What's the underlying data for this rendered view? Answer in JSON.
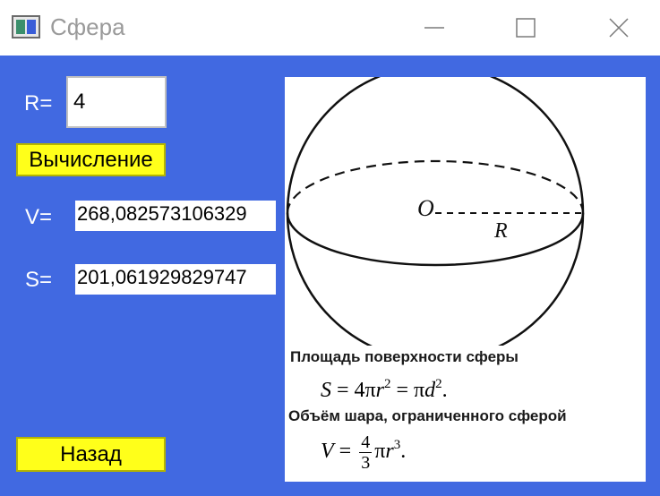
{
  "window": {
    "title": "Сфера"
  },
  "form": {
    "r_label": "R=",
    "r_value": "4",
    "calc_button": "Вычисление",
    "v_label": "V=",
    "v_value": "268,082573106329",
    "s_label": "S=",
    "s_value": "201,061929829747",
    "back_button": "Назад"
  },
  "picture": {
    "center_label": "O",
    "radius_label": "R",
    "caption_surface": "Площадь поверхности сферы",
    "formula_surface": {
      "lhs": "S",
      "eq1": " = 4π",
      "r": "r",
      "r_exp": "2",
      "eq2": " = π",
      "d": "d",
      "d_exp": "2",
      "end": "."
    },
    "caption_volume": "Объём шара, ограниченного сферой",
    "formula_volume": {
      "lhs": "V",
      "eq": " = ",
      "num": "4",
      "den": "3",
      "pi": "π",
      "r": "r",
      "r_exp": "3",
      "end": "."
    }
  },
  "colors": {
    "client_background": "#4169e1",
    "button_yellow": "#ffff1a",
    "title_text": "#9a9a9a"
  },
  "icons": [
    "app-icon",
    "minimize-icon",
    "maximize-icon",
    "close-icon"
  ]
}
